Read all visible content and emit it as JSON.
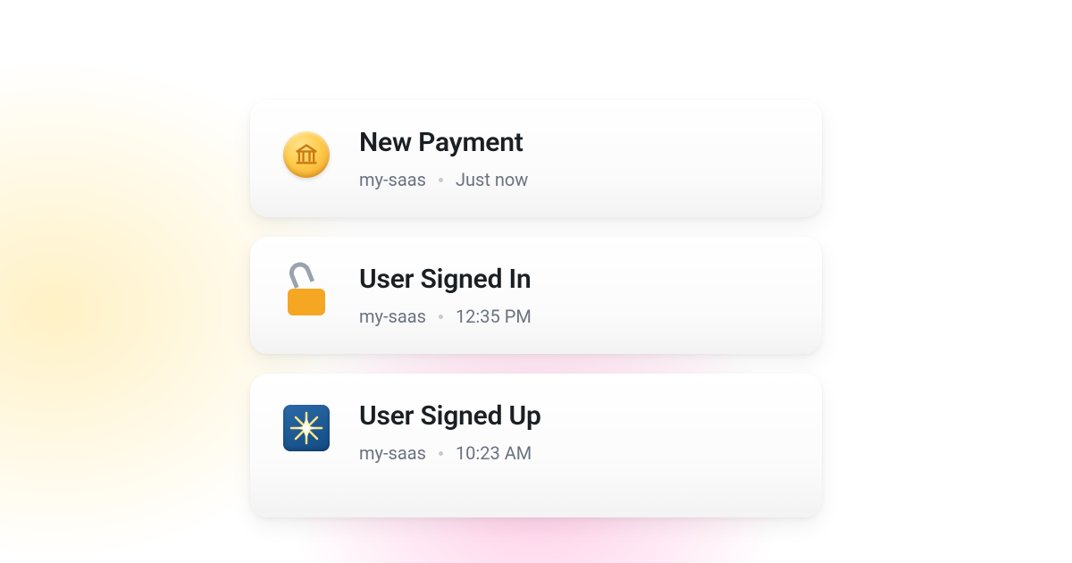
{
  "notifications": [
    {
      "title": "New Payment",
      "project": "my-saas",
      "time": "Just now",
      "icon": "coin-bank"
    },
    {
      "title": "User Signed In",
      "project": "my-saas",
      "time": "12:35 PM",
      "icon": "unlock"
    },
    {
      "title": "User Signed Up",
      "project": "my-saas",
      "time": "10:23 AM",
      "icon": "sparkle-tile"
    }
  ]
}
